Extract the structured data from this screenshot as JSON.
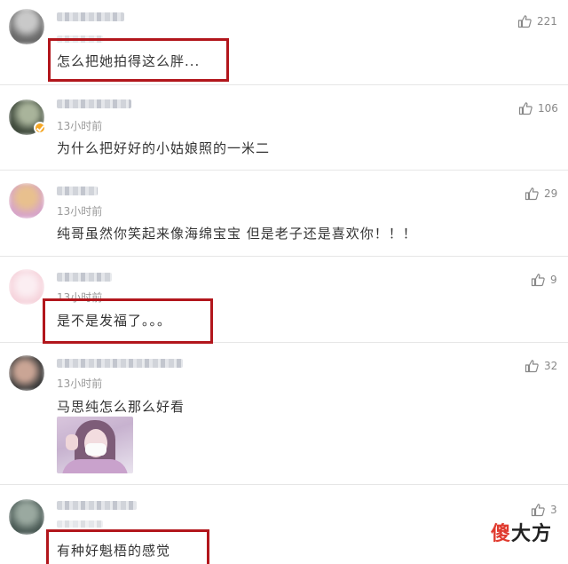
{
  "comments": [
    {
      "time": "",
      "text": "怎么把她拍得这么胖...",
      "likes": "221",
      "avatar_colors": [
        "#6b6b6b",
        "#c9c9c9"
      ]
    },
    {
      "time": "13小时前",
      "text": "为什么把好好的小姑娘照的一米二",
      "likes": "106",
      "avatar_colors": [
        "#3f4a3c",
        "#a9b49b"
      ],
      "verified": true
    },
    {
      "time": "13小时前",
      "text": "纯哥虽然你笑起来像海绵宝宝  但是老子还是喜欢你！！！",
      "likes": "29",
      "avatar_colors": [
        "#d7a5c9",
        "#e8c08e"
      ]
    },
    {
      "time": "13小时前",
      "text": "是不是发福了。。。",
      "likes": "9",
      "avatar_colors": [
        "#f6d4dc",
        "#fbeef2"
      ]
    },
    {
      "time": "13小时前",
      "text": "马思纯怎么那么好看",
      "likes": "32",
      "avatar_colors": [
        "#3b3b3b",
        "#caa595"
      ],
      "has_image": true
    },
    {
      "time": "",
      "text": "有种好魁梧的感觉",
      "likes": "3",
      "avatar_colors": [
        "#4a5a55",
        "#9aa9a0"
      ]
    }
  ],
  "watermark": {
    "part1": "傻",
    "part2": "大方"
  },
  "colors": {
    "highlight": "#b2161c",
    "text": "#333333",
    "meta": "#999999"
  },
  "icons": {
    "like": "thumbs-up-icon"
  }
}
